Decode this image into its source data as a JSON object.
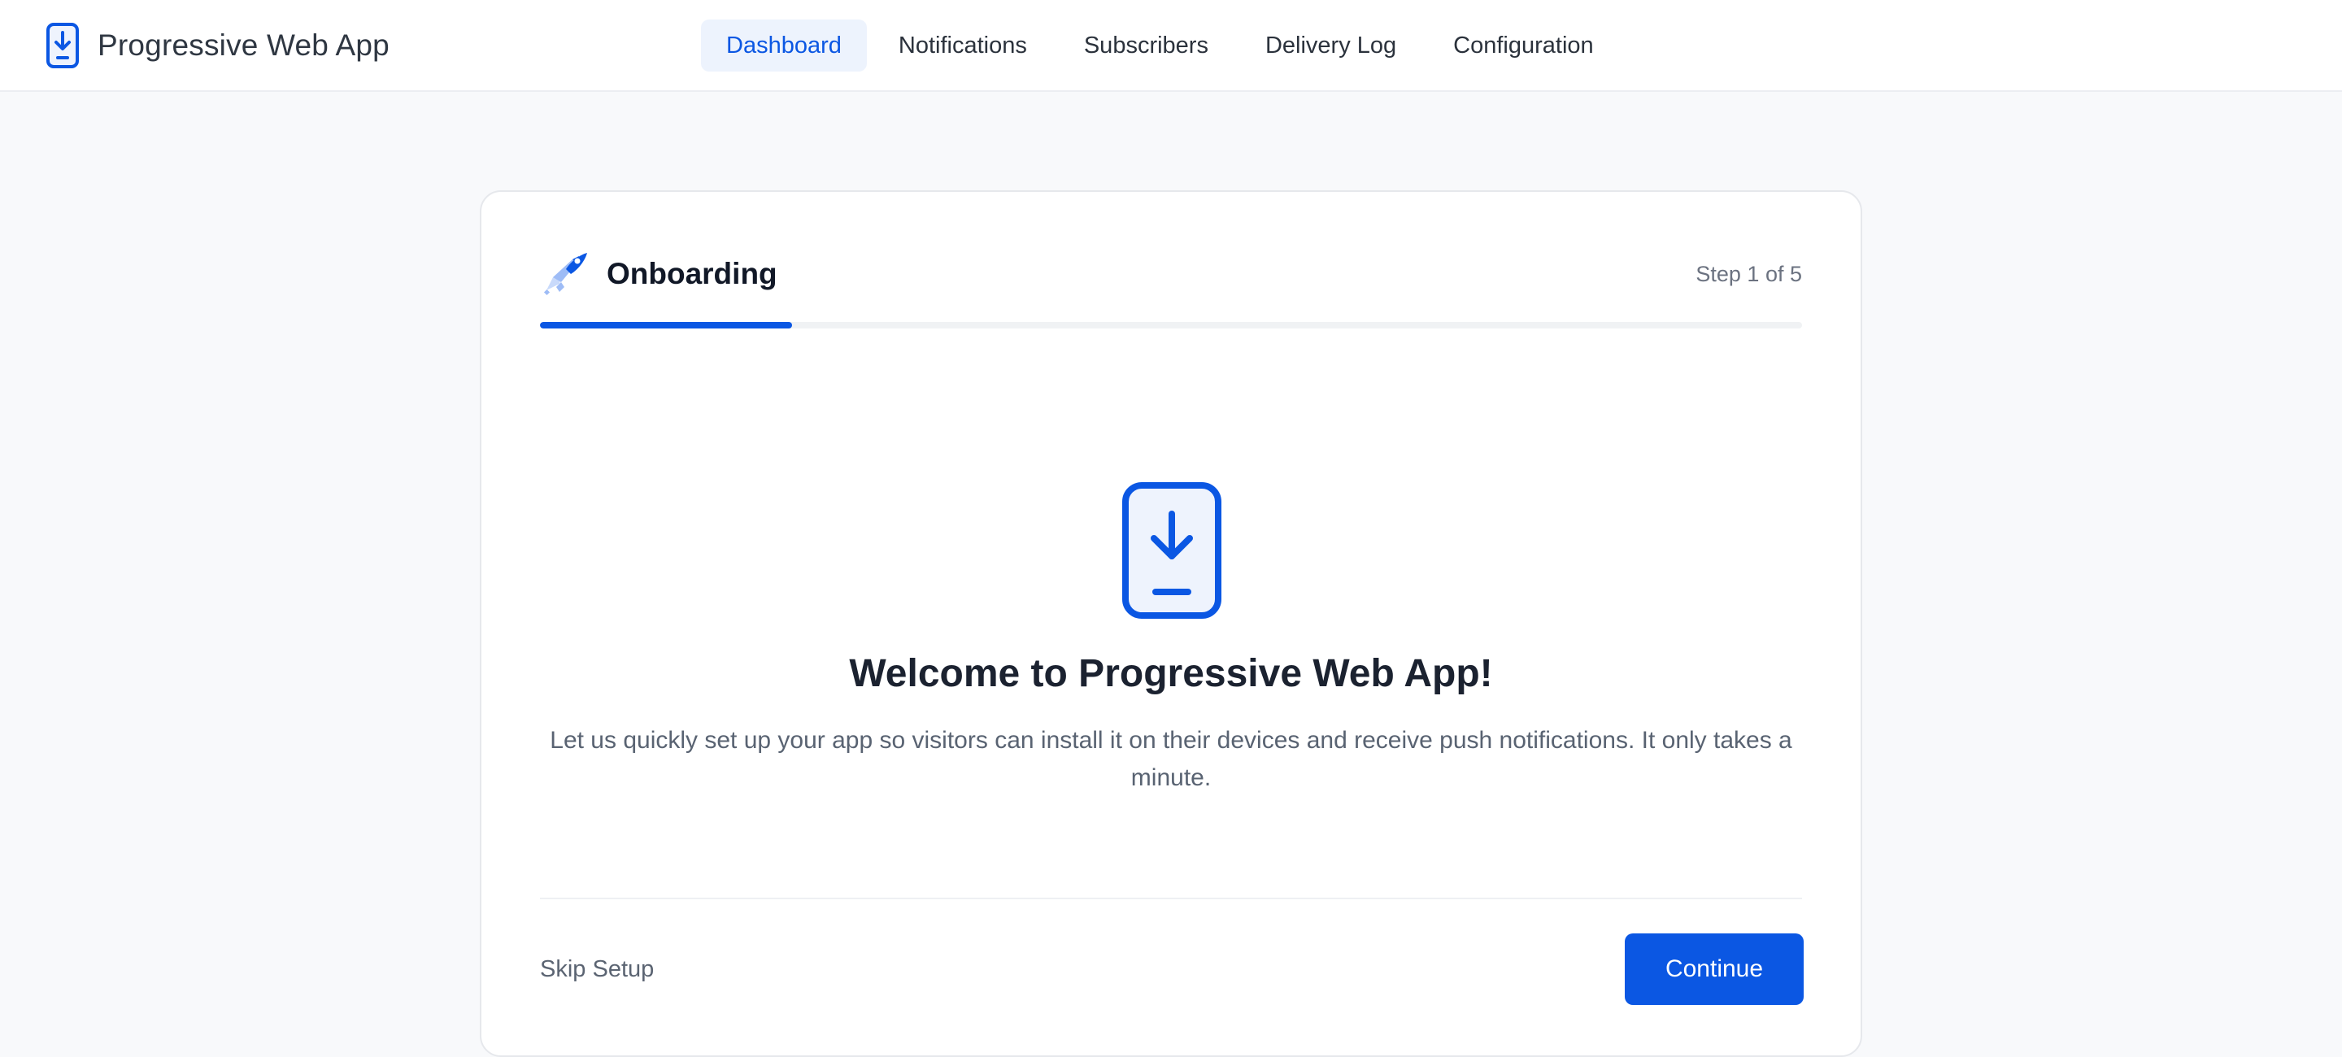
{
  "app": {
    "name": "Progressive Web App",
    "logo_icon": "phone-download-icon"
  },
  "nav": {
    "items": [
      {
        "label": "Dashboard",
        "active": true
      },
      {
        "label": "Notifications",
        "active": false
      },
      {
        "label": "Subscribers",
        "active": false
      },
      {
        "label": "Delivery Log",
        "active": false
      },
      {
        "label": "Configuration",
        "active": false
      }
    ]
  },
  "onboarding": {
    "title": "Onboarding",
    "title_icon": "rocket-icon",
    "step_label": "Step 1 of 5",
    "current_step": 1,
    "total_steps": 5,
    "progress_fraction": 0.2,
    "hero_icon": "phone-download-icon",
    "welcome_title": "Welcome to Progressive Web App!",
    "welcome_description": "Let us quickly set up your app so visitors can install it on their devices and receive push notifications. It only takes a minute.",
    "skip_label": "Skip Setup",
    "continue_label": "Continue"
  },
  "colors": {
    "accent": "#0b57e3",
    "nav_active_bg": "#edf3fd",
    "page_bg": "#f8f9fb"
  }
}
